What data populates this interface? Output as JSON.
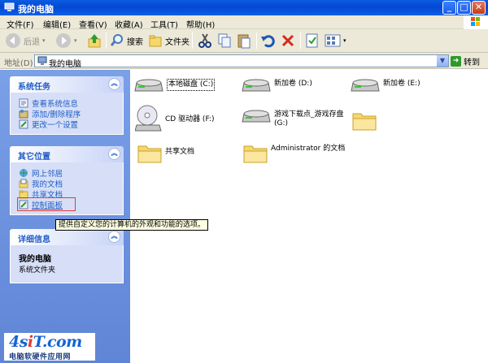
{
  "window": {
    "title": "我的电脑",
    "min_glyph": "_",
    "max_glyph": "□",
    "close_glyph": "✕"
  },
  "menu": [
    "文件(F)",
    "编辑(E)",
    "查看(V)",
    "收藏(A)",
    "工具(T)",
    "帮助(H)"
  ],
  "toolbar": {
    "back_label": "后退",
    "search_label": "搜索",
    "folders_label": "文件夹"
  },
  "address": {
    "label": "地址(D)",
    "value": "我的电脑",
    "go_label": "转到"
  },
  "sidebar": {
    "system_tasks": {
      "title": "系统任务",
      "items": [
        "查看系统信息",
        "添加/删除程序",
        "更改一个设置"
      ]
    },
    "other_places": {
      "title": "其它位置",
      "items": [
        "网上邻居",
        "我的文档",
        "共享文档",
        "控制面板"
      ]
    },
    "details": {
      "title": "详细信息",
      "name": "我的电脑",
      "type": "系统文件夹"
    }
  },
  "items": {
    "drive_c": "本地磁盘 (C:)",
    "drive_d": "新加卷 (D:)",
    "drive_e": "新加卷 (E:)",
    "cd_f": "CD 驱动器 (F:)",
    "drive_g": "游戏下载点_游戏存盘 (G:)",
    "shared_docs": "共享文档",
    "admin_docs": "Administrator 的文档"
  },
  "tooltip": "提供自定义您的计算机的外观和功能的选项。",
  "watermark": {
    "logo_main": "4s",
    "logo_accent": "i",
    "logo_end": "T.com",
    "sub": "电脑软硬件应用网"
  },
  "colors": {
    "titlebar": "#0a5ce0",
    "sidebar": "#7aa0e8",
    "link": "#215dc6",
    "highlight": "#e23a3a"
  }
}
